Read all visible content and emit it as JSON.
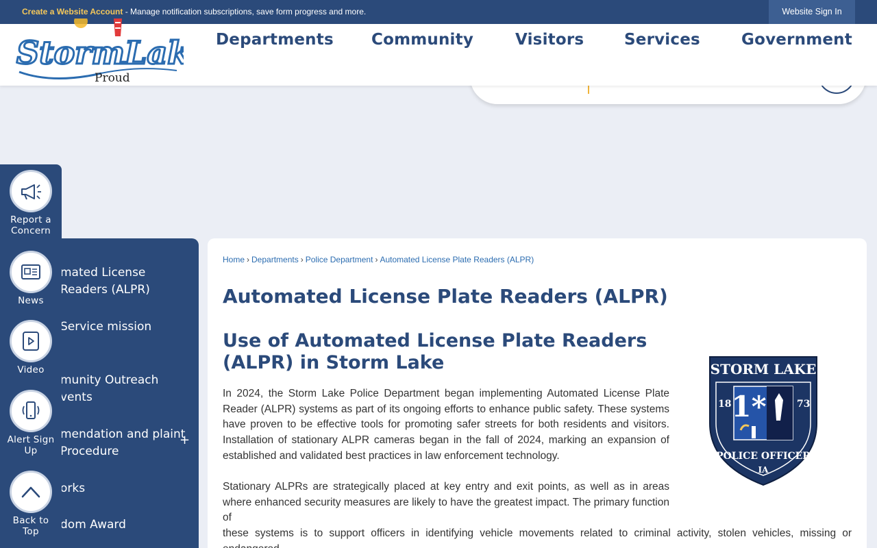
{
  "topbar": {
    "account_link": "Create a Website Account",
    "account_text": " - Manage notification subscriptions, save form progress and more.",
    "signin_label": "Website Sign In"
  },
  "header": {
    "logo_text": "StormLake",
    "logo_subtext": "Proud",
    "nav": [
      "Departments",
      "Community",
      "Visitors",
      "Services",
      "Government"
    ]
  },
  "quick_links": [
    {
      "label": "Report a Concern",
      "icon": "megaphone-icon"
    },
    {
      "label": "News",
      "icon": "newspaper-icon"
    },
    {
      "label": "Video",
      "icon": "video-icon"
    },
    {
      "label": "Alert Sign Up",
      "icon": "phone-alert-icon"
    },
    {
      "label": "Back to Top",
      "icon": "chevron-up-icon"
    }
  ],
  "sidenav": {
    "items": [
      "Automated License Plate Readers (ALPR)",
      "Civil Service Commission",
      "Community Outreach Events",
      "Commendation and Complaint Procedure",
      "Networks",
      "Freedom Award"
    ],
    "visible_items": [
      "mated License Readers (ALPR)",
      "Service mission",
      "munity Outreach vents",
      "mendation and plaint Procedure",
      "orks",
      "dom Award"
    ],
    "expand_symbol": "+"
  },
  "breadcrumb": {
    "items": [
      "Home",
      "Departments",
      "Police Department",
      "Automated License Plate Readers (ALPR)"
    ],
    "separator": "›"
  },
  "page_title": "Automated License Plate Readers (ALPR)",
  "section_heading": "Use of Automated License Plate Readers (ALPR) in Storm Lake",
  "paragraphs": [
    "In 2024, the Storm Lake Police Department began implementing Automated License Plate Reader (ALPR) systems as part of its ongoing efforts to enhance public safety. These systems have proven to be effective tools for promoting safer streets for both residents and visitors. Installation of stationary ALPR cameras began in the fall of 2024, marking an expansion of established and validated best practices in law enforcement technology.",
    "Stationary ALPRs are strategically placed at key entry and exit points, as well as in areas where enhanced security measures are likely to have the greatest impact. The primary function of",
    "these systems is to support officers in identifying vehicle movements related to criminal activity, stolen vehicles, missing or endangered"
  ],
  "badge": {
    "top": "STORM LAKE",
    "number": "1*",
    "left_year": "18",
    "right_year": "73",
    "bottom": "POLICE OFFICER",
    "state": "IA"
  },
  "colors": {
    "brand_navy": "#2b4a7a",
    "accent_gold": "#f5c85a",
    "link_blue": "#2b6cb0"
  }
}
